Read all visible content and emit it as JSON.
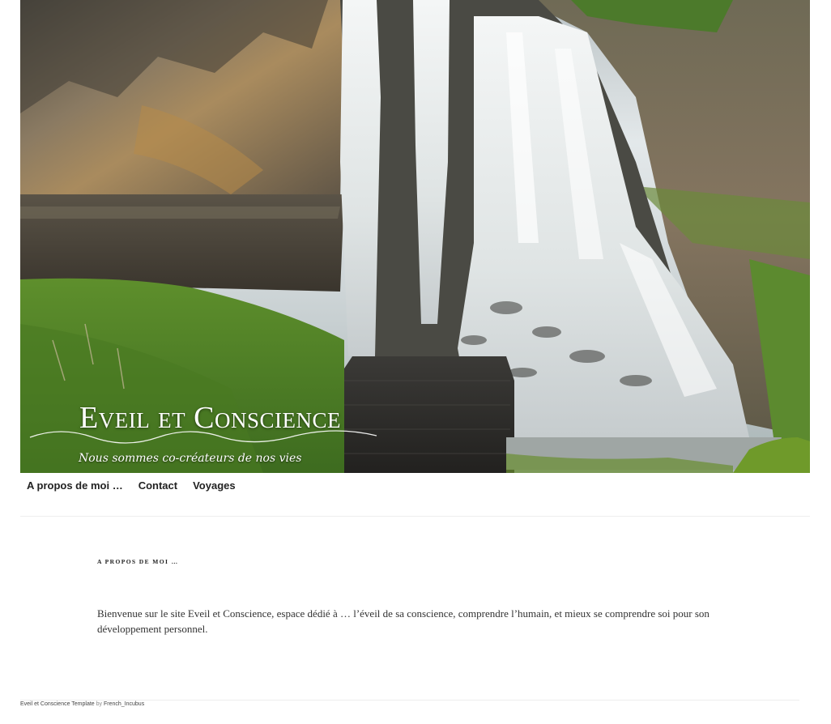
{
  "site": {
    "title": "Eveil et Conscience",
    "tagline": "Nous sommes co-créateurs de nos vies"
  },
  "hero": {
    "image_description_icon": "waterfall-photo"
  },
  "nav": {
    "items": [
      {
        "label": "A propos de moi …"
      },
      {
        "label": "Contact"
      },
      {
        "label": "Voyages"
      }
    ]
  },
  "page": {
    "title": "A propos de moi …",
    "body": "Bienvenue sur le site Eveil et Conscience, espace dédié à … l’éveil de sa conscience, comprendre l’humain, et mieux se comprendre soi pour son développement personnel."
  },
  "footer": {
    "template_link": "Eveil et Conscience Template",
    "by_text": " by ",
    "author": "French_Incubus"
  }
}
